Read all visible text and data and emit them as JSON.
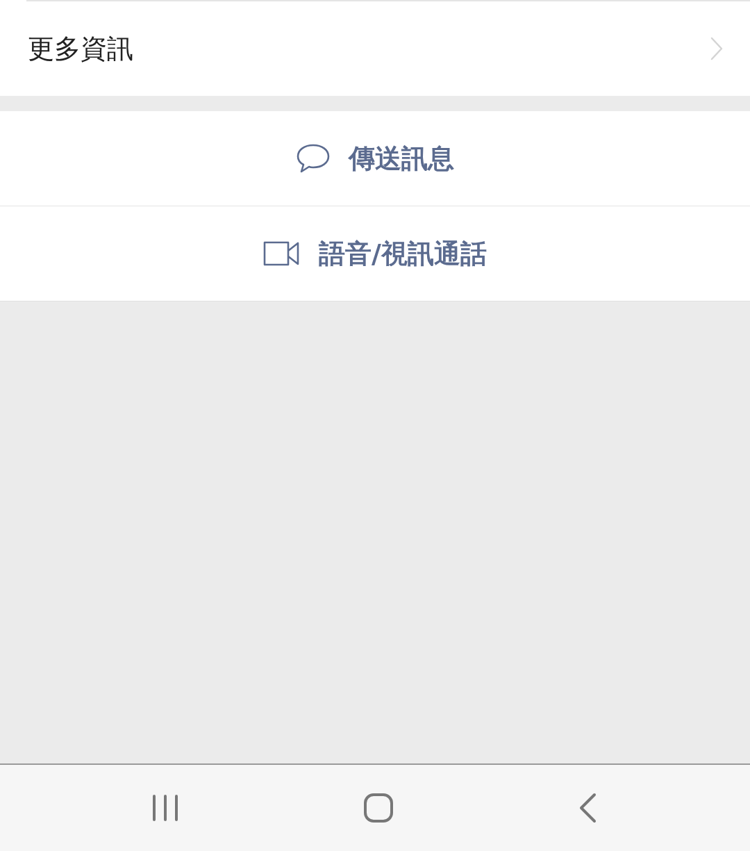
{
  "more_info": {
    "label": "更多資訊"
  },
  "actions": [
    {
      "kind": "message",
      "label": "傳送訊息"
    },
    {
      "kind": "call",
      "label": "語音/視訊通話"
    }
  ]
}
